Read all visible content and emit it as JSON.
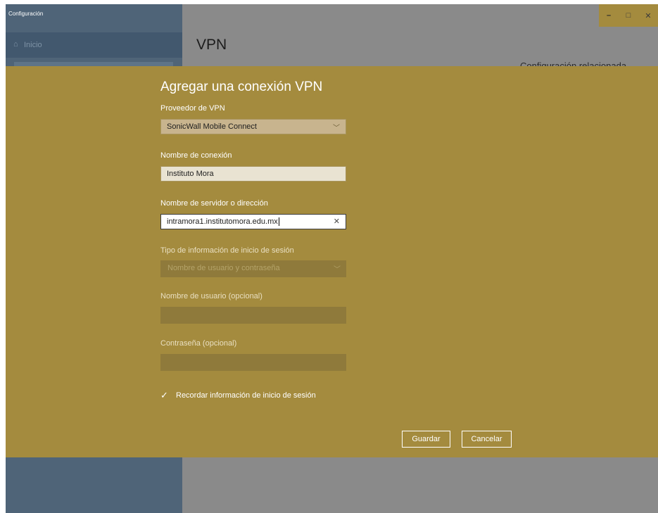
{
  "window": {
    "title": "Configuración",
    "controls": {
      "minimize": "–",
      "maximize": "□",
      "close": "✕"
    }
  },
  "sidebar": {
    "home_icon": "⌂",
    "home_label": "Inicio"
  },
  "page": {
    "title": "VPN",
    "related_settings": "Configuración relacionada"
  },
  "dialog": {
    "title": "Agregar una conexión VPN",
    "provider": {
      "label": "Proveedor de VPN",
      "value": "SonicWall Mobile Connect"
    },
    "connection_name": {
      "label": "Nombre de conexión",
      "value": "Instituto Mora"
    },
    "server": {
      "label": "Nombre de servidor o dirección",
      "value": "intramora1.institutomora.edu.mx"
    },
    "signin_type": {
      "label": "Tipo de información de inicio de sesión",
      "value": "Nombre de usuario y contraseña"
    },
    "username": {
      "label": "Nombre de usuario (opcional)",
      "value": ""
    },
    "password": {
      "label": "Contraseña (opcional)",
      "value": ""
    },
    "remember": {
      "label": "Recordar información de inicio de sesión",
      "checked": true
    },
    "buttons": {
      "save": "Guardar",
      "cancel": "Cancelar"
    }
  },
  "colors": {
    "dialog_bg": "#a48b3e",
    "sidebar_bg": "#4f6478",
    "main_bg": "#8a8a8a"
  },
  "icons": {
    "home": "home-icon",
    "chevron": "chevron-down-icon",
    "clear": "clear-icon",
    "check": "check-icon"
  }
}
